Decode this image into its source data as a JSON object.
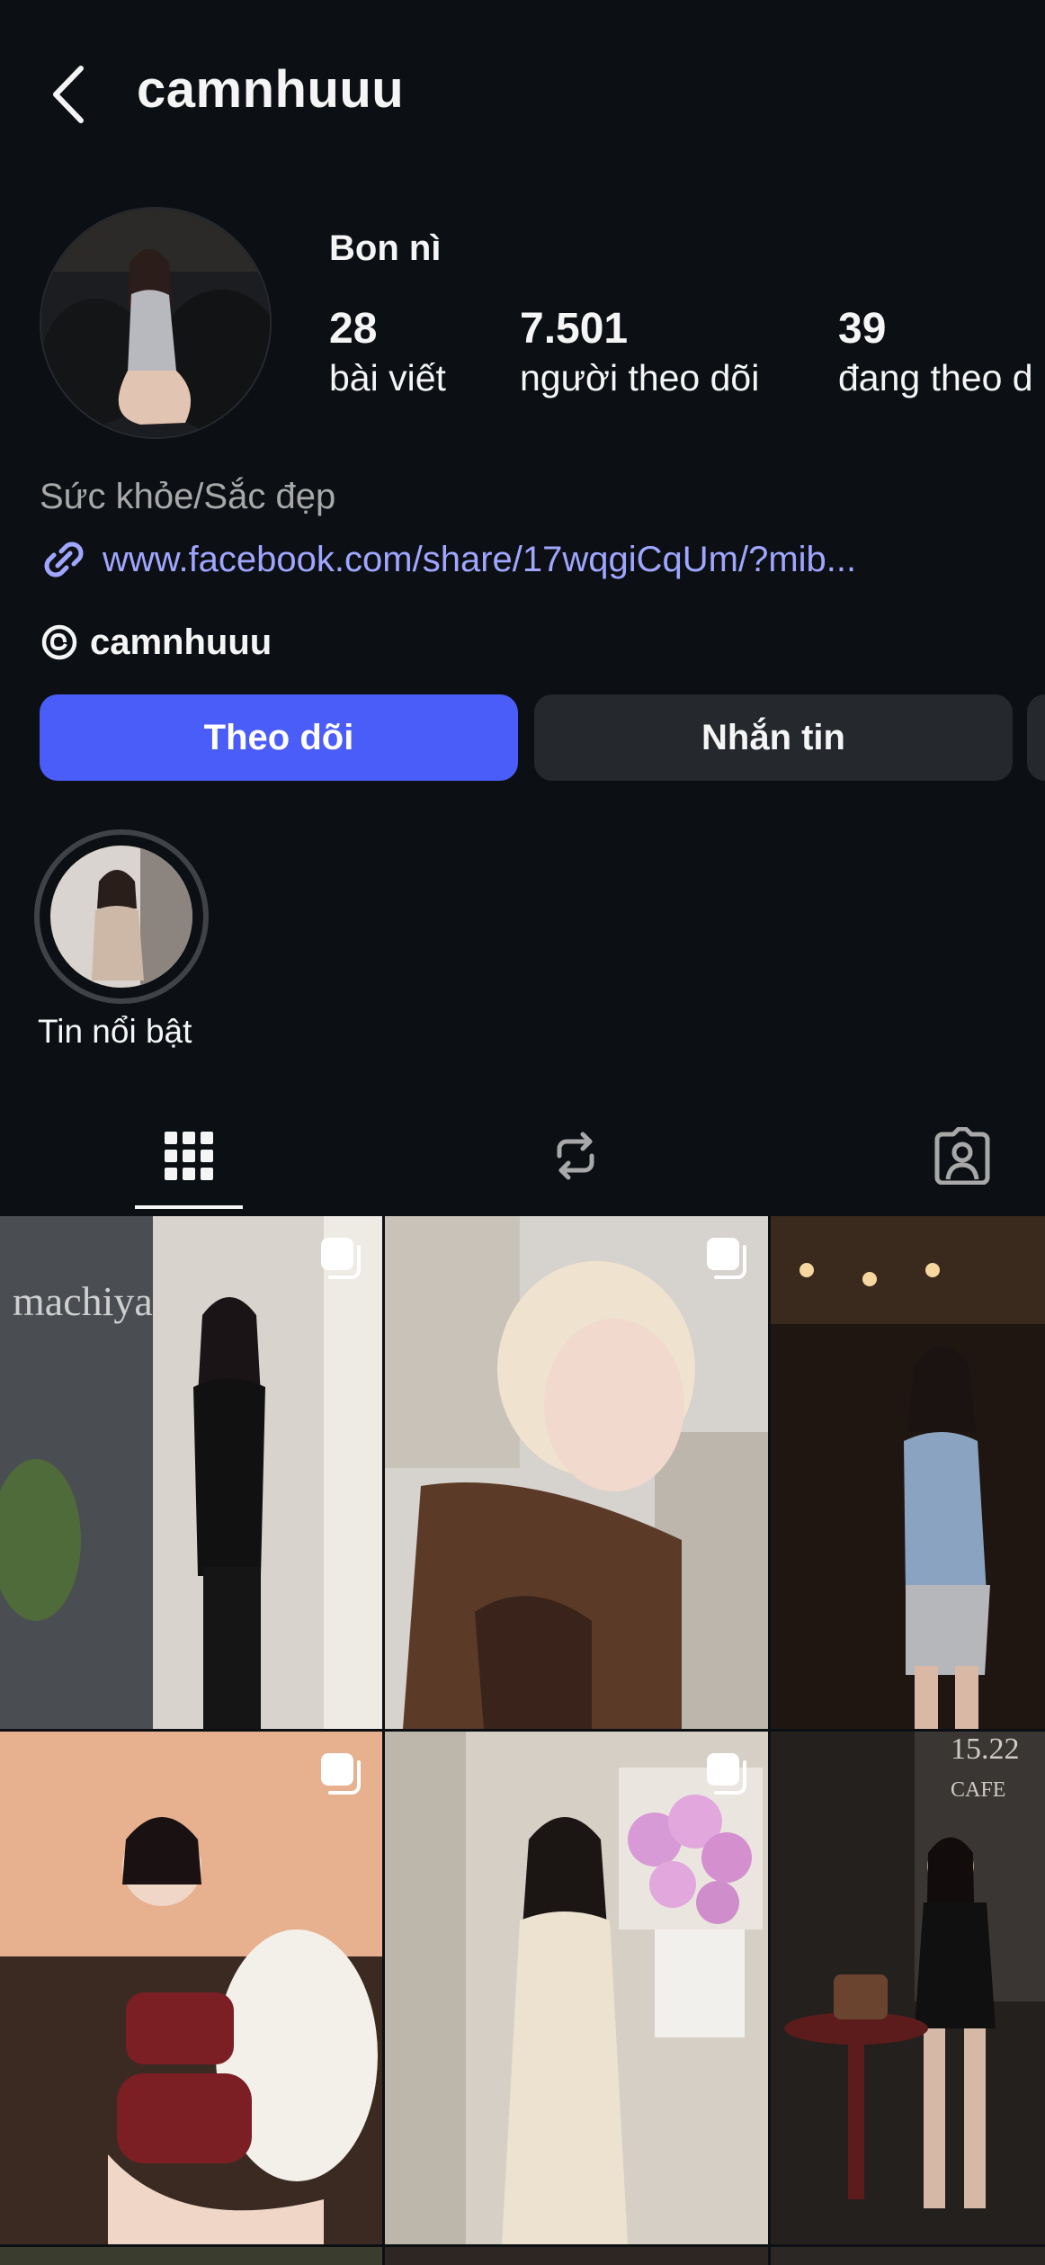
{
  "header": {
    "username": "camnhuuu"
  },
  "profile": {
    "display_name": "Bon nì",
    "stats": [
      {
        "value": "28",
        "label": "bài viết"
      },
      {
        "value": "7.501",
        "label": "người theo dõi"
      },
      {
        "value": "39",
        "label": "đang theo d"
      }
    ],
    "category": "Sức khỏe/Sắc đẹp",
    "link": "www.facebook.com/share/17wqgiCqUm/?mib...",
    "threads_handle": "camnhuuu"
  },
  "actions": {
    "follow": "Theo dõi",
    "message": "Nhắn tin"
  },
  "highlights": [
    {
      "label": "Tin nổi bật"
    }
  ],
  "tabs": [
    {
      "icon": "grid-icon",
      "active": true
    },
    {
      "icon": "reels-repost-icon",
      "active": false
    },
    {
      "icon": "tagged-icon",
      "active": false
    }
  ],
  "colors": {
    "background": "#0c1014",
    "accent": "#4a5df9",
    "link": "#a0a6ff",
    "button_secondary": "#25292e"
  },
  "posts": [
    {
      "multi": true
    },
    {
      "multi": true
    },
    {
      "multi": false
    },
    {
      "multi": true
    },
    {
      "multi": true
    },
    {
      "multi": false
    }
  ]
}
